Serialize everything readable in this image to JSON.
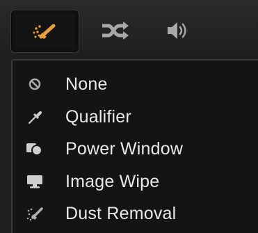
{
  "toolbar": {
    "tools": [
      {
        "icon": "magic-wand-icon",
        "active": true
      },
      {
        "icon": "shuffle-icon",
        "active": false
      },
      {
        "icon": "speaker-icon",
        "active": false
      }
    ]
  },
  "menu": {
    "items": [
      {
        "label": "None",
        "icon": "prohibited-icon"
      },
      {
        "label": "Qualifier",
        "icon": "eyedropper-icon"
      },
      {
        "label": "Power Window",
        "icon": "power-window-icon"
      },
      {
        "label": "Image Wipe",
        "icon": "monitor-icon"
      },
      {
        "label": "Dust Removal",
        "icon": "dust-removal-icon"
      }
    ]
  },
  "colors": {
    "accent": "#e8a13a",
    "icon": "#a8a8a8",
    "text": "#e9e9e9",
    "menu_bg": "#141414"
  }
}
